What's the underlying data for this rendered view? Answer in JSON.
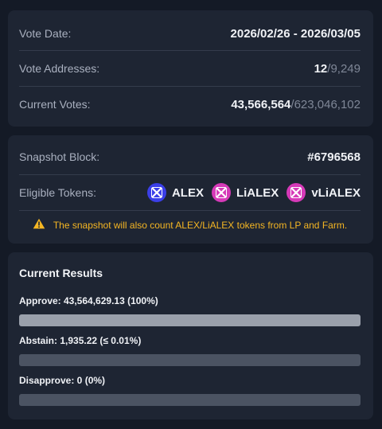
{
  "vote_info": {
    "vote_date_label": "Vote Date:",
    "vote_date_value": "2026/02/26 - 2026/03/05",
    "addresses_label": "Vote Addresses:",
    "addresses_current": "12",
    "addresses_sep": "/",
    "addresses_total": "9,249",
    "votes_label": "Current Votes:",
    "votes_current": "43,566,564",
    "votes_sep": "/",
    "votes_total": "623,046,102"
  },
  "snapshot": {
    "block_label": "Snapshot Block:",
    "block_value": "#6796568",
    "tokens_label": "Eligible Tokens:",
    "tokens": [
      {
        "name": "ALEX",
        "icon": "alex-token-icon",
        "color": "#3b3fe8"
      },
      {
        "name": "LiALEX",
        "icon": "lialex-token-icon",
        "color": "#d63ab8"
      },
      {
        "name": "vLiALEX",
        "icon": "vlialex-token-icon",
        "color": "#d63ab8"
      }
    ],
    "notice_icon": "warning-icon",
    "notice": "The snapshot will also count ALEX/LiALEX tokens from LP and Farm."
  },
  "results": {
    "title": "Current Results",
    "items": [
      {
        "label": "Approve: 43,564,629.13 (100%)",
        "fraction": 1.0
      },
      {
        "label": "Abstain: 1,935.22 (≤ 0.01%)",
        "fraction": 4.44e-05
      },
      {
        "label": "Disapprove: 0 (0%)",
        "fraction": 0
      }
    ]
  },
  "colors": {
    "background": "#141a26",
    "card": "#1e2533",
    "warning": "#f5b623",
    "bar_track": "#4b5362",
    "bar_fill": "#9aa0ab"
  }
}
